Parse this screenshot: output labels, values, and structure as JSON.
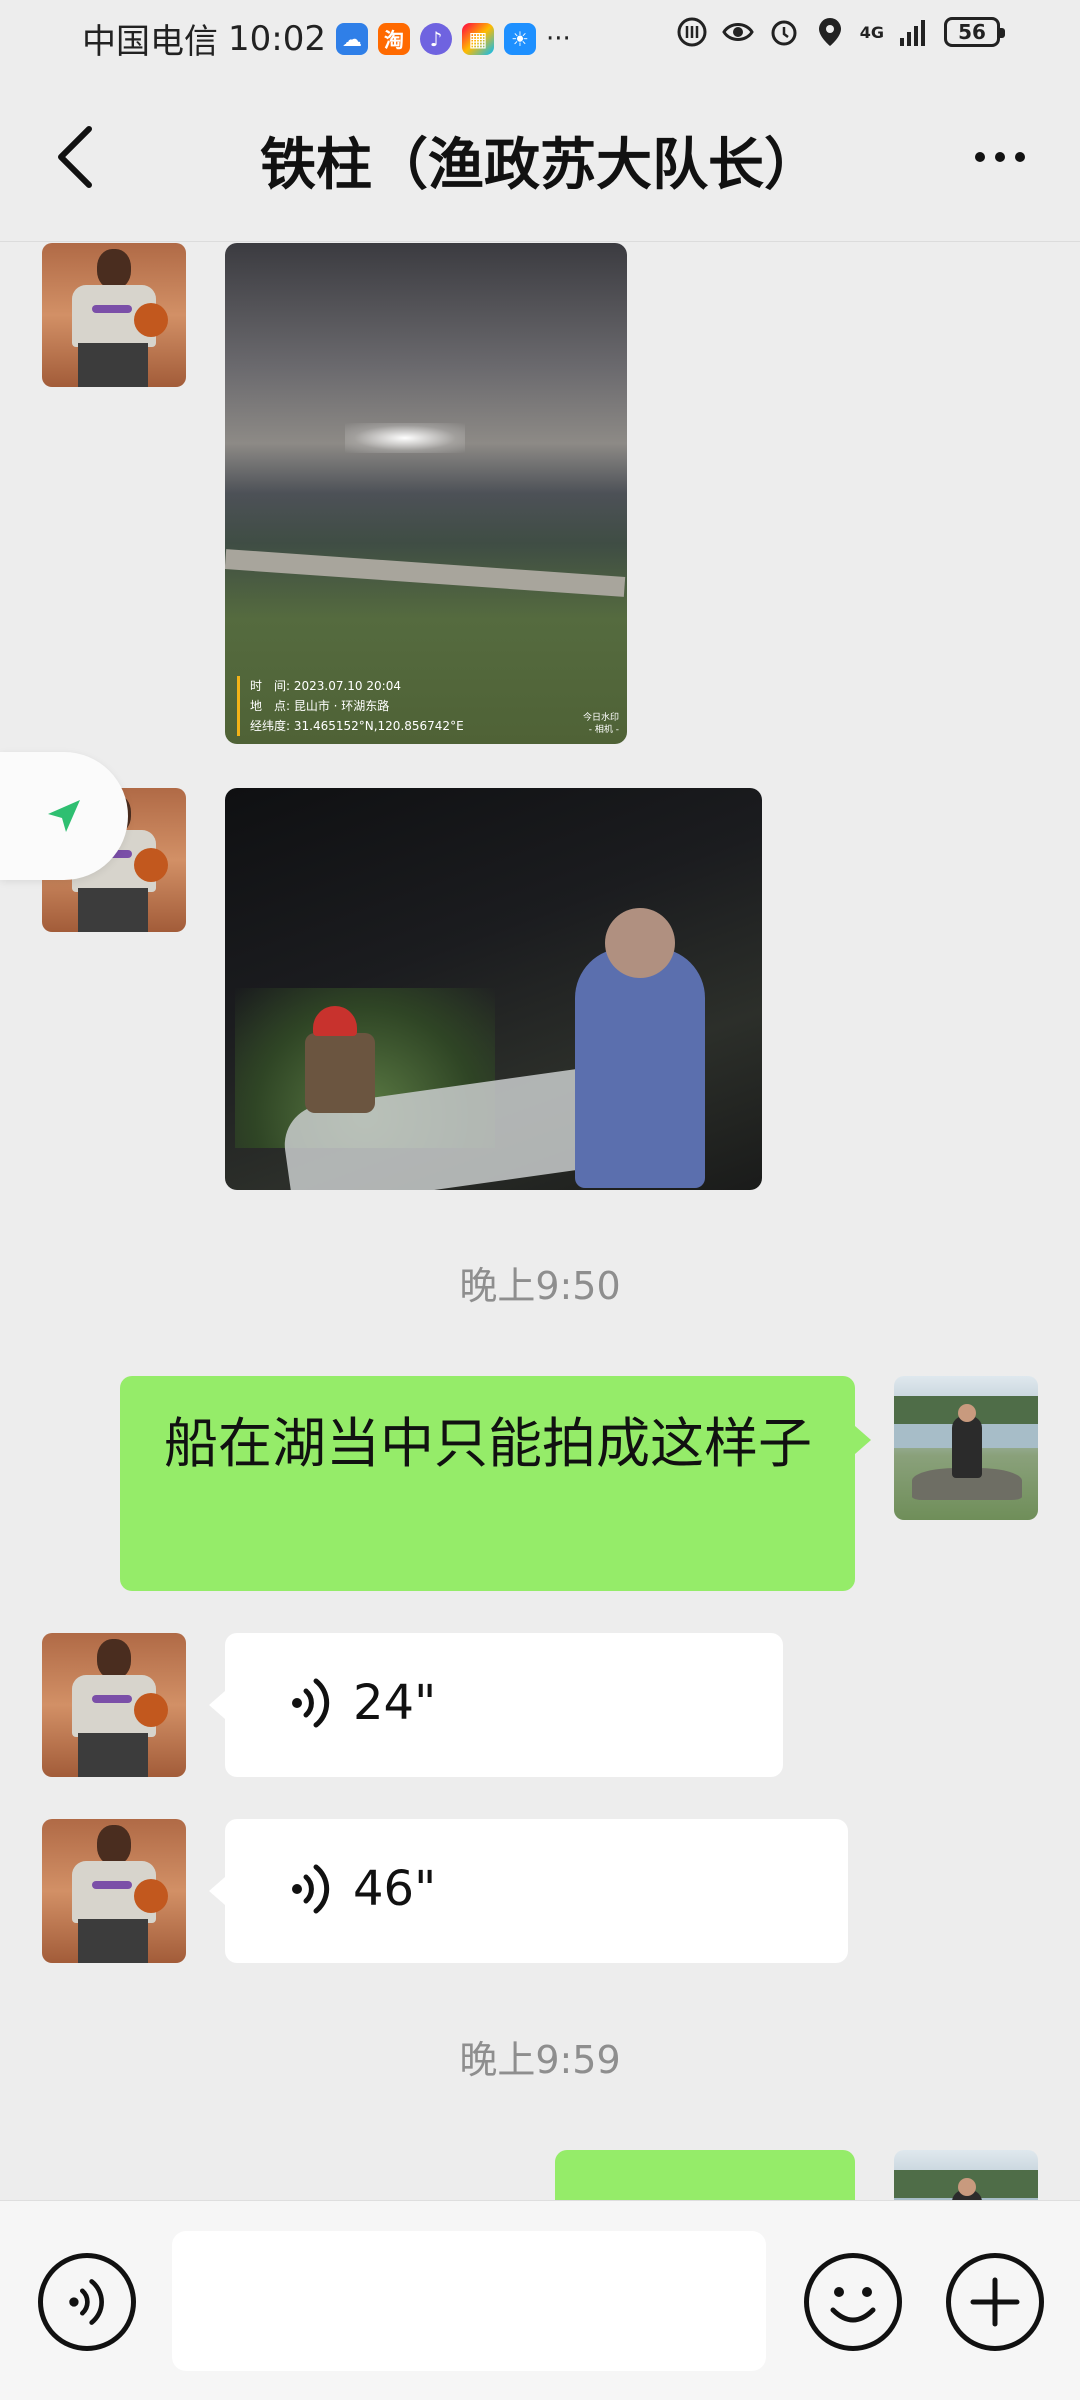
{
  "status_bar": {
    "carrier": "中国电信",
    "time": "10:02",
    "more_indicator": "···",
    "network": "4G",
    "battery": "56",
    "app_icons": [
      "cloud-icon",
      "taobao-icon",
      "music-icon",
      "gallery-icon",
      "weather-icon"
    ]
  },
  "header": {
    "title": "铁柱（渔政苏大队长）"
  },
  "messages": [
    {
      "kind": "image",
      "side": "left",
      "watermark_time": "时　间: 2023.07.10 20:04",
      "watermark_place": "地　点: 昆山市 · 环湖东路",
      "watermark_coords": "经纬度: 31.465152°N,120.856742°E",
      "watermark_brand": "今日水印\n- 相机 -"
    },
    {
      "kind": "image",
      "side": "left"
    },
    {
      "kind": "time",
      "text": "晚上9:50"
    },
    {
      "kind": "text",
      "side": "right",
      "text": "船在湖当中只能拍成这样子"
    },
    {
      "kind": "voice",
      "side": "left",
      "duration": "24\""
    },
    {
      "kind": "voice",
      "side": "left",
      "duration": "46\""
    },
    {
      "kind": "time",
      "text": "晚上9:59"
    },
    {
      "kind": "text",
      "side": "right",
      "text": ""
    }
  ],
  "input_bar": {
    "placeholder": "",
    "value": ""
  },
  "colors": {
    "background": "#ededed",
    "outgoing_bubble": "#95ec69",
    "incoming_bubble": "#ffffff",
    "timestamp": "#8e8e8e",
    "location_arrow": "#2fbf71"
  }
}
